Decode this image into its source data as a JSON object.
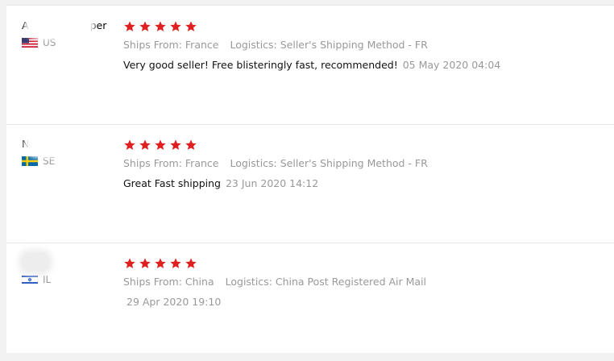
{
  "colors": {
    "star": "#e02020",
    "meta": "#999999",
    "text": "#111111"
  },
  "reviews": [
    {
      "name_start": "A",
      "name_end": "per",
      "country": "US",
      "flag_icon": "us-flag-icon",
      "rating": 5,
      "ships_from": "Ships From: France",
      "logistics": "Logistics: Seller's Shipping Method - FR",
      "text": "Very good seller! Free blisteringly fast, recommended!",
      "date": "05 May 2020 04:04"
    },
    {
      "name_start": "N",
      "name_end": "",
      "country": "SE",
      "flag_icon": "sweden-flag-icon",
      "rating": 5,
      "ships_from": "Ships From: France",
      "logistics": "Logistics: Seller's Shipping Method - FR",
      "text": "Great Fast shipping",
      "date": "23 Jun 2020 14:12"
    },
    {
      "name_start": "",
      "name_end": "",
      "country": "IL",
      "flag_icon": "israel-flag-icon",
      "rating": 5,
      "ships_from": "Ships From: China",
      "logistics": "Logistics: China Post Registered Air Mail",
      "text": "",
      "date": "29 Apr 2020 19:10"
    }
  ]
}
